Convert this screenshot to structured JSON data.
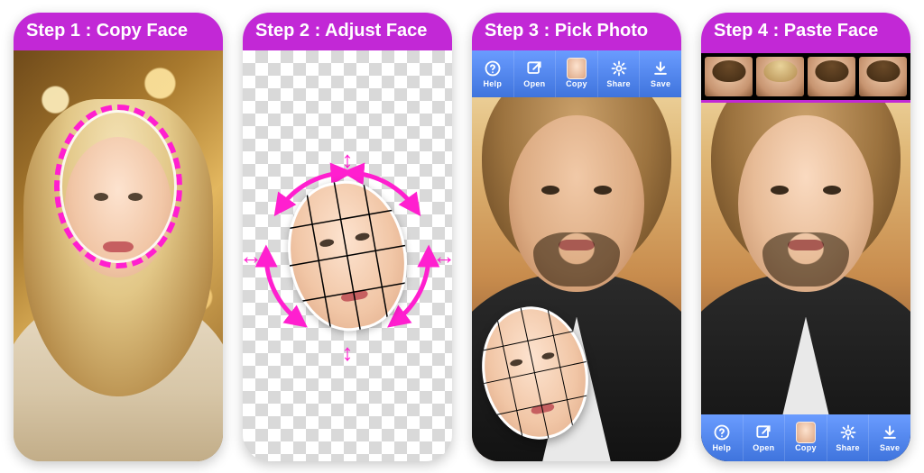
{
  "accent_color": "#c228d6",
  "magenta": "#ff1fcf",
  "steps": [
    {
      "title": "Step 1 : Copy Face"
    },
    {
      "title": "Step 2 : Adjust Face"
    },
    {
      "title": "Step 3 : Pick Photo"
    },
    {
      "title": "Step 4 : Paste Face"
    }
  ],
  "toolbar": {
    "help": "Help",
    "open": "Open",
    "copy": "Copy",
    "share": "Share",
    "save": "Save"
  },
  "face_strip_count": 4
}
